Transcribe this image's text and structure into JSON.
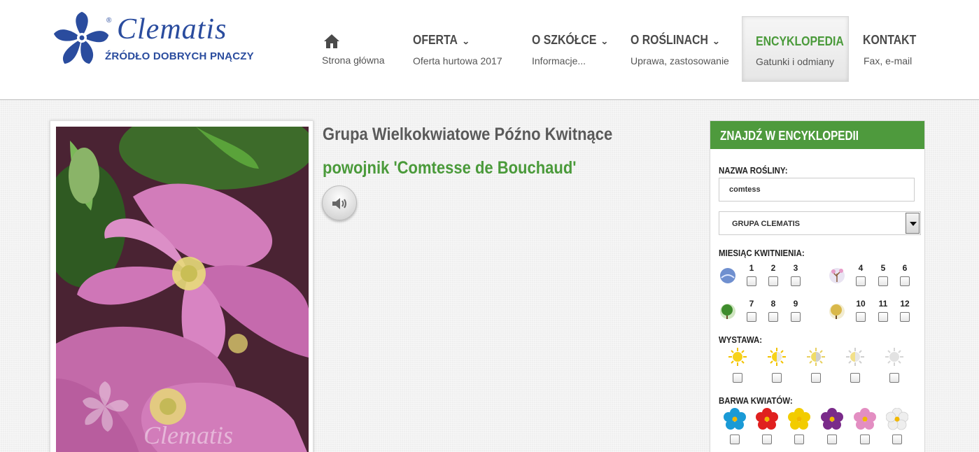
{
  "logo": {
    "script": "Clematis",
    "tagline": "ŹRÓDŁO DOBRYCH PNĄCZY",
    "reg": "®"
  },
  "nav": [
    {
      "title": "",
      "sub": "Strona główna",
      "icon": "home-icon"
    },
    {
      "title": "OFERTA",
      "sub": "Oferta hurtowa 2017",
      "dropdown": true
    },
    {
      "title": "O SZKÓŁCE",
      "sub": "Informacje...",
      "dropdown": true
    },
    {
      "title": "O ROŚLINACH",
      "sub": "Uprawa, zastosowanie",
      "dropdown": true
    },
    {
      "title": "ENCYKLOPEDIA",
      "sub": "Gatunki i odmiany",
      "active": true
    },
    {
      "title": "KONTAKT",
      "sub": "Fax, e-mail"
    }
  ],
  "plant": {
    "group_title": "Grupa Wielkokwiatowe Późno Kwitnące",
    "name": "powojnik 'Comtesse de Bouchaud'",
    "photo_watermark": "Clematis"
  },
  "search": {
    "heading": "ZNAJDŹ W ENCYKLOPEDII",
    "name_label": "NAZWA ROŚLINY:",
    "name_value": "comtess",
    "group_select": "GRUPA CLEMATIS",
    "month_label": "MIESIĄC KWITNIENIA:",
    "months": [
      "1",
      "2",
      "3",
      "4",
      "5",
      "6",
      "7",
      "8",
      "9",
      "10",
      "11",
      "12"
    ],
    "exposure_label": "WYSTAWA:",
    "color_label": "BARWA KWIATÓW:",
    "flower_colors": [
      "#1a9ad6",
      "#e0201f",
      "#f2cc00",
      "#7a2b8a",
      "#e38ec2",
      "#eeeeee"
    ]
  },
  "colors": {
    "brand_blue": "#2a4c9e",
    "accent_green": "#4e9a3d"
  }
}
